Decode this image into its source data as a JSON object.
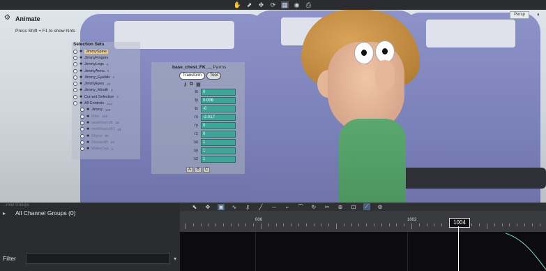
{
  "topbar": {
    "icons": [
      "hand-icon",
      "select-icon",
      "move-icon",
      "rotate-icon",
      "grid-icon",
      "camera-icon",
      "print-icon"
    ],
    "active_index": 4
  },
  "hud": {
    "title": "Animate",
    "hint": "Press Shift + F1 to show hints",
    "view_label": "Persp",
    "camera_icon": "camera-icon"
  },
  "selection_sets": {
    "title": "Selection Sets",
    "items": [
      {
        "label": "JimmySpine",
        "count": "",
        "highlight": true
      },
      {
        "label": "JimmyFingers",
        "count": ""
      },
      {
        "label": "JimmyLegs",
        "count": "8"
      },
      {
        "label": "JimmyArms",
        "count": "6"
      },
      {
        "label": "Jimmy_Eyelids",
        "count": "6"
      },
      {
        "label": "JimmyEyes",
        "count": "28"
      },
      {
        "label": "Jimmy_Mouth",
        "count": "6"
      },
      {
        "label": "Current Selection",
        "count": "0"
      },
      {
        "label": "All Controls",
        "count": "412"
      },
      {
        "label": "Jimmy",
        "count": "123",
        "indent": true
      },
      {
        "label": "Mike",
        "count": "123",
        "indent": true,
        "dim": true
      },
      {
        "label": "seatRowLeft",
        "count": "16",
        "indent": true,
        "dim": true
      },
      {
        "label": "seatRowLeft1",
        "count": "16",
        "indent": true,
        "dim": true
      },
      {
        "label": "Sheryl",
        "count": "97",
        "indent": true,
        "dim": true
      },
      {
        "label": "StewardB",
        "count": "44",
        "indent": true,
        "dim": true
      },
      {
        "label": "WaterCup",
        "count": "4",
        "indent": true,
        "dim": true
      }
    ]
  },
  "parms": {
    "title": "base_chest_FK_...",
    "title_suffix": "Parms",
    "tabs": [
      {
        "label": "Transform",
        "active": true
      },
      {
        "label": "Tool",
        "active": false
      }
    ],
    "fields": [
      {
        "label": "tx",
        "value": "0"
      },
      {
        "label": "ty",
        "value": "0.006"
      },
      {
        "label": "tz",
        "value": "-0"
      },
      {
        "label": "rx",
        "value": "-2.017"
      },
      {
        "label": "ry",
        "value": "0"
      },
      {
        "label": "rz",
        "value": "0"
      },
      {
        "label": "sx",
        "value": "1"
      },
      {
        "label": "sy",
        "value": "1"
      },
      {
        "label": "sz",
        "value": "1"
      }
    ],
    "bottom_buttons": [
      "A",
      "B",
      "C"
    ]
  },
  "channel_groups": {
    "header": "...nnel Groups",
    "item": "All Channel Groups (0)"
  },
  "filter": {
    "label": "Filter",
    "value": ""
  },
  "timeline": {
    "ticks": [
      {
        "label": "006"
      },
      {
        "label": "1002"
      }
    ],
    "current_frame": "1004"
  }
}
